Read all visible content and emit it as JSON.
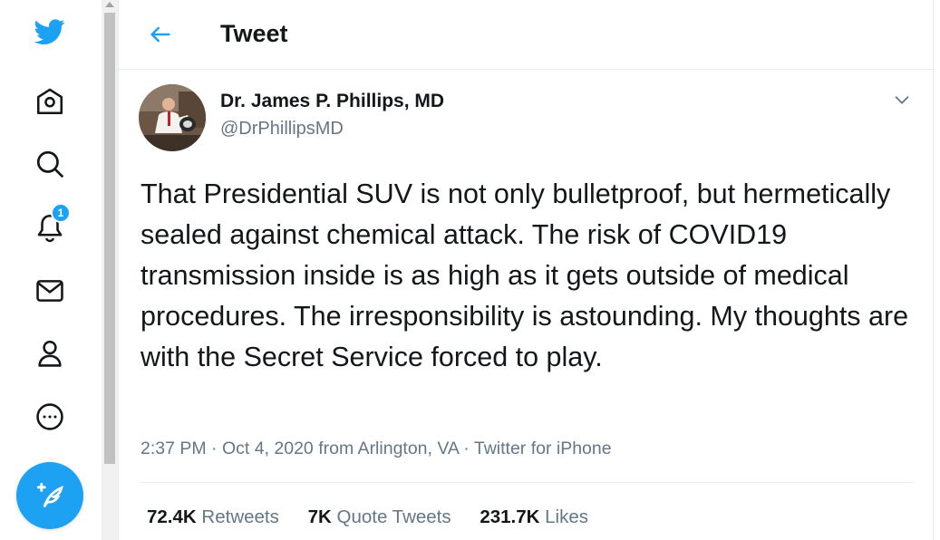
{
  "colors": {
    "brand": "#1da1f2",
    "text": "#14171a",
    "muted": "#657786",
    "border": "#e6ecf0"
  },
  "nav": {
    "logo_icon": "twitter-bird-icon",
    "items": [
      {
        "icon": "home-icon"
      },
      {
        "icon": "search-icon"
      },
      {
        "icon": "bell-icon",
        "badge": "1"
      },
      {
        "icon": "mail-icon"
      },
      {
        "icon": "profile-icon"
      },
      {
        "icon": "more-circle-icon"
      }
    ],
    "compose_icon": "compose-feather-icon"
  },
  "header": {
    "title": "Tweet",
    "back_icon": "arrow-left-icon"
  },
  "tweet": {
    "author_name": "Dr. James P. Phillips, MD",
    "handle": "@DrPhillipsMD",
    "more_icon": "chevron-down-icon",
    "text": "That Presidential SUV is not only bulletproof, but hermetically sealed against chemical attack. The risk of COVID19 transmission inside is as high as it gets outside of medical procedures. The irresponsibility is astounding. My thoughts are with the Secret Service forced to play.",
    "time": "2:37 PM",
    "date": "Oct 4, 2020",
    "location": "from Arlington, VA",
    "source": "Twitter for iPhone",
    "separator": "·"
  },
  "stats": {
    "retweets_count": "72.4K",
    "retweets_label": "Retweets",
    "quotes_count": "7K",
    "quotes_label": "Quote Tweets",
    "likes_count": "231.7K",
    "likes_label": "Likes"
  }
}
